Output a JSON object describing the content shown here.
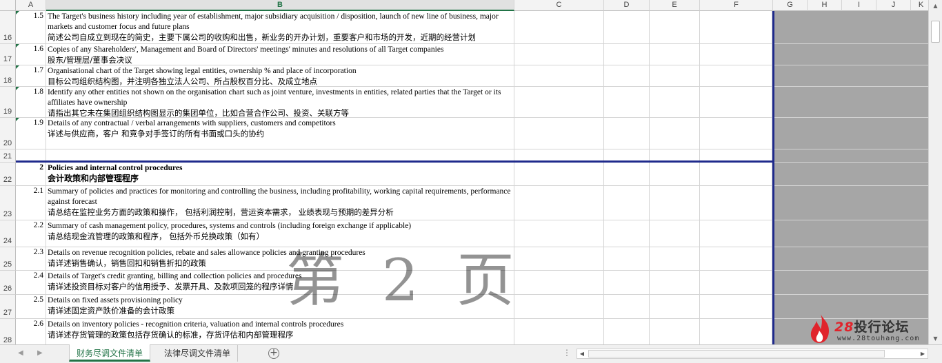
{
  "columns": [
    "A",
    "B",
    "C",
    "D",
    "E",
    "F",
    "G",
    "H",
    "I",
    "J",
    "K"
  ],
  "rows": [
    {
      "num": "16",
      "id": "1.5",
      "en": "The Target's business history including year of establishment, major subsidiary acquisition / disposition, launch of new line of business, major markets and customer focus and future plans",
      "cn": "简述公司自成立到现在的简史，主要下属公司的收购和出售，新业务的开办计划，重要客户和市场的开发，近期的经营计划"
    },
    {
      "num": "17",
      "id": "1.6",
      "en": "Copies of any Shareholders', Management and Board of Directors' meetings' minutes and resolutions of all Target companies",
      "cn": "股东/管理层/董事会决议"
    },
    {
      "num": "18",
      "id": "1.7",
      "en": "Organisational chart of the Target showing legal entities, ownership % and place of incorporation",
      "cn": "目标公司组织结构图，并注明各独立法人公司、所占股权百分比、及成立地点"
    },
    {
      "num": "19",
      "id": "1.8",
      "en": "Identify any other entities not shown on the organisation chart such as joint venture, investments in entities, related parties that the Target or its affiliates have ownership",
      "cn": "请指出其它未在集团组织结构图显示的集团单位，比如合营合作公司、投资、关联方等"
    },
    {
      "num": "20",
      "id": "1.9",
      "en": "Details of any contractual / verbal arrangements with suppliers, customers and competitors",
      "cn": "详述与供应商，客户 和竞争对手签订的所有书面或口头的协约"
    },
    {
      "num": "21",
      "id": "",
      "en": "",
      "cn": ""
    },
    {
      "num": "22",
      "id": "2",
      "en": "Policies and internal control procedures",
      "cn": "会计政策和内部管理程序"
    },
    {
      "num": "23",
      "id": "2.1",
      "en": "Summary of policies and practices for monitoring and controlling the business, including profitability, working capital requirements, performance against forecast",
      "cn": "请总结在监控业务方面的政策和操作， 包括利润控制，营运资本需求， 业绩表现与预期的差异分析"
    },
    {
      "num": "24",
      "id": "2.2",
      "en": "Summary of cash management policy, procedures, systems and controls (including foreign exchange if applicable)",
      "cn": "请总结现金流管理的政策和程序， 包括外币兑换政策（如有）"
    },
    {
      "num": "25",
      "id": "2.3",
      "en": "Details on revenue recognition policies, rebate and sales allowance policies and granting procedures",
      "cn": "请详述销售确认，销售回扣和销售折扣的政策"
    },
    {
      "num": "26",
      "id": "2.4",
      "en": "Details of Target's credit granting, billing and collection policies and procedures",
      "cn": "请详述投资目标对客户的信用授予、发票开具、及款项回笼的程序详情"
    },
    {
      "num": "27",
      "id": "2.5",
      "en": "Details on fixed assets provisioning policy",
      "cn": "请详述固定资产跌价准备的会计政策"
    },
    {
      "num": "28",
      "id": "2.6",
      "en": "Details on inventory policies - recognition criteria, valuation and internal controls procedures",
      "cn": "请详述存货管理的政策包括存货确认的标准，存货评估和内部管理程序"
    }
  ],
  "watermark": "第 2 页",
  "logo": {
    "number": "28",
    "name": "投行论坛",
    "url": "www.28touhang.com"
  },
  "sheets": [
    "财务尽调文件清单",
    "法律尽调文件清单"
  ],
  "colors": {
    "accent": "#217346",
    "section_border": "#1f2a8c",
    "grey_area": "#a6a6a6",
    "logo_red": "#e0242c"
  }
}
